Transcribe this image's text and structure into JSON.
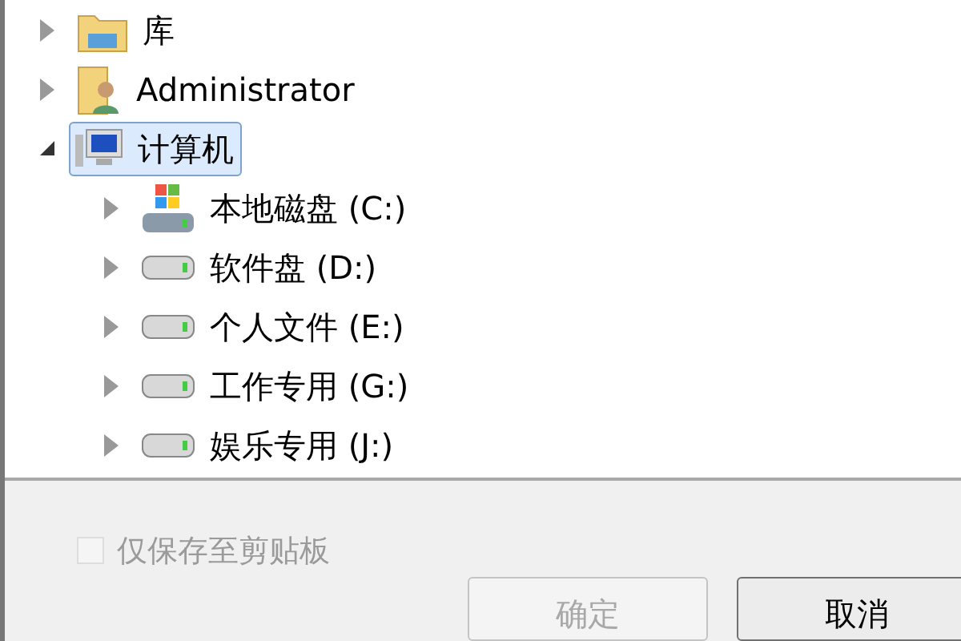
{
  "tree": [
    {
      "label": "库",
      "kind": "library",
      "expanded": false,
      "selected": false
    },
    {
      "label": "Administrator",
      "kind": "user",
      "expanded": false,
      "selected": false
    },
    {
      "label": "计算机",
      "kind": "computer",
      "expanded": true,
      "selected": true,
      "children": [
        {
          "label": "本地磁盘 (C:)",
          "kind": "system",
          "expanded": false,
          "selected": false
        },
        {
          "label": "软件盘 (D:)",
          "kind": "drive",
          "expanded": false,
          "selected": false
        },
        {
          "label": "个人文件 (E:)",
          "kind": "drive",
          "expanded": false,
          "selected": false
        },
        {
          "label": "工作专用 (G:)",
          "kind": "drive",
          "expanded": false,
          "selected": false
        },
        {
          "label": "娱乐专用 (J:)",
          "kind": "drive",
          "expanded": false,
          "selected": false
        }
      ]
    }
  ],
  "clipboard_option": {
    "label": "仅保存至剪贴板",
    "checked": false,
    "disabled": true
  },
  "buttons": [
    {
      "label": "确定",
      "disabled": true
    },
    {
      "label": "取消",
      "disabled": false
    }
  ]
}
